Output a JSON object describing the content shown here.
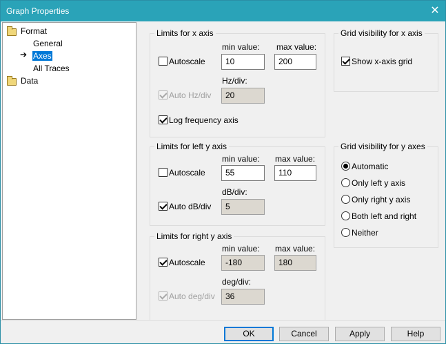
{
  "window": {
    "title": "Graph Properties"
  },
  "tree": {
    "format": "Format",
    "general": "General",
    "axes": "Axes",
    "all_traces": "All Traces",
    "data": "Data"
  },
  "x_axis": {
    "title": "Limits for x axis",
    "autoscale_label": "Autoscale",
    "min_label": "min value:",
    "max_label": "max value:",
    "min_value": "10",
    "max_value": "200",
    "per_div_label": "Hz/div:",
    "per_div_value": "20",
    "auto_div_label": "Auto Hz/div",
    "log_label": "Log frequency axis"
  },
  "grid_x": {
    "title": "Grid visibility for x axis",
    "show_label": "Show x-axis grid"
  },
  "left_y": {
    "title": "Limits for left y axis",
    "autoscale_label": "Autoscale",
    "min_label": "min value:",
    "max_label": "max value:",
    "min_value": "55",
    "max_value": "110",
    "per_div_label": "dB/div:",
    "per_div_value": "5",
    "auto_div_label": "Auto dB/div"
  },
  "grid_y": {
    "title": "Grid visibility for y axes",
    "options": [
      "Automatic",
      "Only left y axis",
      "Only right y axis",
      "Both left and right",
      "Neither"
    ]
  },
  "right_y": {
    "title": "Limits for right y axis",
    "autoscale_label": "Autoscale",
    "min_label": "min value:",
    "max_label": "max value:",
    "min_value": "-180",
    "max_value": "180",
    "per_div_label": "deg/div:",
    "per_div_value": "36",
    "auto_div_label": "Auto deg/div"
  },
  "buttons": {
    "ok": "OK",
    "cancel": "Cancel",
    "apply": "Apply",
    "help": "Help"
  },
  "colors": {
    "titlebar": "#2aa3b8",
    "selection": "#0078d7"
  }
}
